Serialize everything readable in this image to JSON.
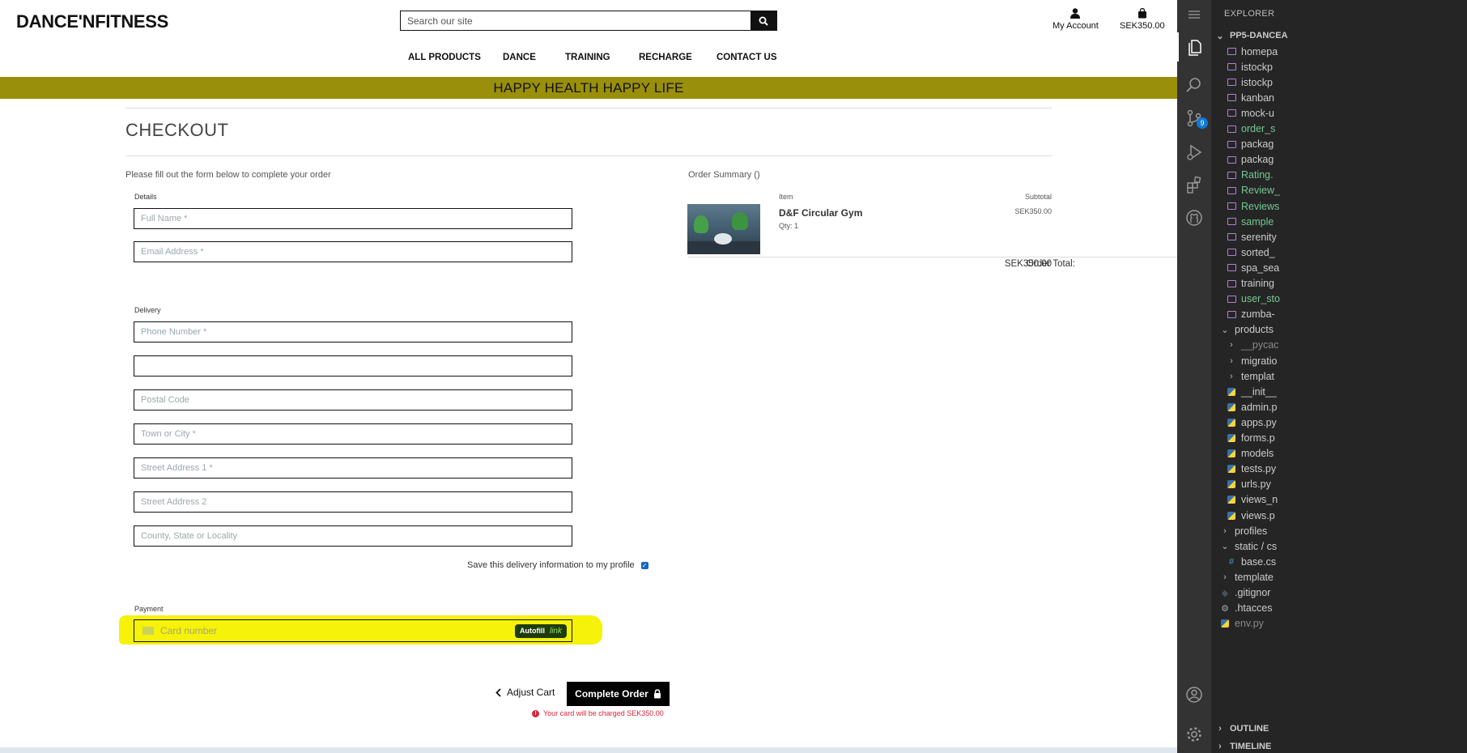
{
  "site": {
    "logo": "DANCE'NFITNESS",
    "search_placeholder": "Search our site",
    "account_label": "My Account",
    "cart_total": "SEK350.00",
    "nav": [
      "ALL PRODUCTS",
      "DANCE",
      "TRAINING",
      "RECHARGE",
      "CONTACT US"
    ],
    "banner": "HAPPY HEALTH HAPPY LIFE",
    "page_title": "CHECKOUT",
    "form_intro": "Please fill out the form below to complete your order",
    "details_label": "Details",
    "details_fields": [
      "Full Name *",
      "Email Address *"
    ],
    "delivery_label": "Delivery",
    "delivery_fields": [
      "Phone Number *",
      "",
      "Postal Code",
      "Town or City *",
      "Street Address 1 *",
      "Street Address 2",
      "County, State or Locality"
    ],
    "save_info_label": "Save this delivery information to my profile",
    "payment_label": "Payment",
    "card_placeholder": "Card number",
    "autofill_label": "Autofill",
    "autofill_link": "link",
    "adjust_cart": "Adjust Cart",
    "complete_order": "Complete Order",
    "charge_notice": "Your card will be charged ",
    "charge_amount": "SEK350.00",
    "order_summary": {
      "title": "Order Summary ()",
      "item_header": "Item",
      "subtotal_header": "Subtotal",
      "item_name": "D&F Circular Gym",
      "item_qty": "Qty: 1",
      "item_subtotal": "SEK350.00",
      "total_label": "Order Total:",
      "total_value": "SEK350.00"
    }
  },
  "vscode": {
    "explorer_title": "EXPLORER",
    "project": "PP5-DANCEA",
    "scm_badge": "9",
    "files": [
      {
        "label": "homepa",
        "kind": "img",
        "color": "normal",
        "indent": 1
      },
      {
        "label": "istockp",
        "kind": "img",
        "color": "normal",
        "indent": 1
      },
      {
        "label": "istockp",
        "kind": "img",
        "color": "normal",
        "indent": 1
      },
      {
        "label": "kanban",
        "kind": "img",
        "color": "normal",
        "indent": 1
      },
      {
        "label": "mock-u",
        "kind": "img",
        "color": "normal",
        "indent": 1
      },
      {
        "label": "order_s",
        "kind": "img",
        "color": "green",
        "indent": 1
      },
      {
        "label": "packag",
        "kind": "img",
        "color": "normal",
        "indent": 1
      },
      {
        "label": "packag",
        "kind": "img",
        "color": "normal",
        "indent": 1
      },
      {
        "label": "Rating.",
        "kind": "img",
        "color": "green",
        "indent": 1
      },
      {
        "label": "Review_",
        "kind": "img",
        "color": "green",
        "indent": 1
      },
      {
        "label": "Reviews",
        "kind": "img",
        "color": "green",
        "indent": 1
      },
      {
        "label": "sample",
        "kind": "img",
        "color": "green",
        "indent": 1
      },
      {
        "label": "serenity",
        "kind": "img",
        "color": "normal",
        "indent": 1
      },
      {
        "label": "sorted_",
        "kind": "img",
        "color": "normal",
        "indent": 1
      },
      {
        "label": "spa_sea",
        "kind": "img",
        "color": "normal",
        "indent": 1
      },
      {
        "label": "training",
        "kind": "img",
        "color": "normal",
        "indent": 1
      },
      {
        "label": "user_sto",
        "kind": "img",
        "color": "green",
        "indent": 1
      },
      {
        "label": "zumba-",
        "kind": "img",
        "color": "normal",
        "indent": 1
      },
      {
        "label": "products",
        "kind": "folder-open",
        "color": "normal",
        "indent": 0
      },
      {
        "label": "__pycac",
        "kind": "folder",
        "color": "dim",
        "indent": 1
      },
      {
        "label": "migratio",
        "kind": "folder",
        "color": "normal",
        "indent": 1
      },
      {
        "label": "templat",
        "kind": "folder",
        "color": "normal",
        "indent": 1
      },
      {
        "label": "__init__",
        "kind": "py",
        "color": "normal",
        "indent": 1
      },
      {
        "label": "admin.p",
        "kind": "py",
        "color": "normal",
        "indent": 1
      },
      {
        "label": "apps.py",
        "kind": "py",
        "color": "normal",
        "indent": 1
      },
      {
        "label": "forms.p",
        "kind": "py",
        "color": "normal",
        "indent": 1
      },
      {
        "label": "models",
        "kind": "py",
        "color": "normal",
        "indent": 1
      },
      {
        "label": "tests.py",
        "kind": "py",
        "color": "normal",
        "indent": 1
      },
      {
        "label": "urls.py",
        "kind": "py",
        "color": "normal",
        "indent": 1
      },
      {
        "label": "views_n",
        "kind": "py",
        "color": "normal",
        "indent": 1
      },
      {
        "label": "views.p",
        "kind": "py",
        "color": "normal",
        "indent": 1
      },
      {
        "label": "profiles",
        "kind": "folder",
        "color": "normal",
        "indent": 0
      },
      {
        "label": "static / cs",
        "kind": "folder-open",
        "color": "normal",
        "indent": 0
      },
      {
        "label": "base.cs",
        "kind": "css",
        "color": "normal",
        "indent": 1
      },
      {
        "label": "template",
        "kind": "folder",
        "color": "normal",
        "indent": 0
      },
      {
        "label": ".gitignor",
        "kind": "git",
        "color": "normal",
        "indent": 0
      },
      {
        "label": ".htacces",
        "kind": "gear",
        "color": "normal",
        "indent": 0
      },
      {
        "label": "env.py",
        "kind": "py",
        "color": "dim",
        "indent": 0
      }
    ],
    "outline_label": "OUTLINE",
    "timeline_label": "TIMELINE"
  }
}
